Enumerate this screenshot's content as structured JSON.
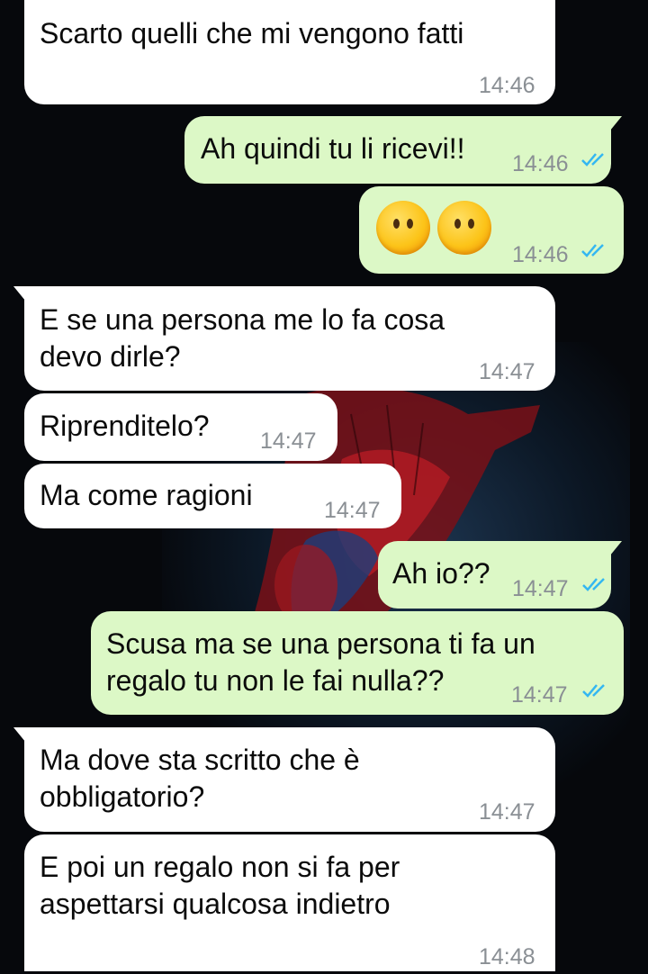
{
  "chat": {
    "messages": [
      {
        "text": "Scarto quelli che mi vengono fatti",
        "time": "14:46"
      },
      {
        "text": "Ah quindi tu li ricevi!!",
        "time": "14:46",
        "status": "read"
      },
      {
        "text": "",
        "emojis": [
          "face-without-mouth",
          "face-without-mouth"
        ],
        "time": "14:46",
        "status": "read"
      },
      {
        "line1": "E se una persona me lo fa cosa",
        "line2": "devo dirle?",
        "time": "14:47"
      },
      {
        "text": "Riprenditelo?",
        "time": "14:47"
      },
      {
        "text": "Ma come ragioni",
        "time": "14:47"
      },
      {
        "text": "Ah io??",
        "time": "14:47",
        "status": "read"
      },
      {
        "line1": "Scusa ma se una persona ti fa un",
        "line2": "regalo tu non le fai nulla??",
        "time": "14:47",
        "status": "read"
      },
      {
        "line1": "Ma dove sta scritto che è",
        "line2": "obbligatorio?",
        "time": "14:47"
      },
      {
        "line1": "E poi un regalo non si fa per",
        "line2": "aspettarsi qualcosa indietro",
        "time": "14:48"
      }
    ]
  },
  "colors": {
    "incoming_bubble": "#ffffff",
    "outgoing_bubble": "#dcf8c6",
    "read_ticks": "#34b7f1",
    "timestamp": "#8a8f94"
  }
}
